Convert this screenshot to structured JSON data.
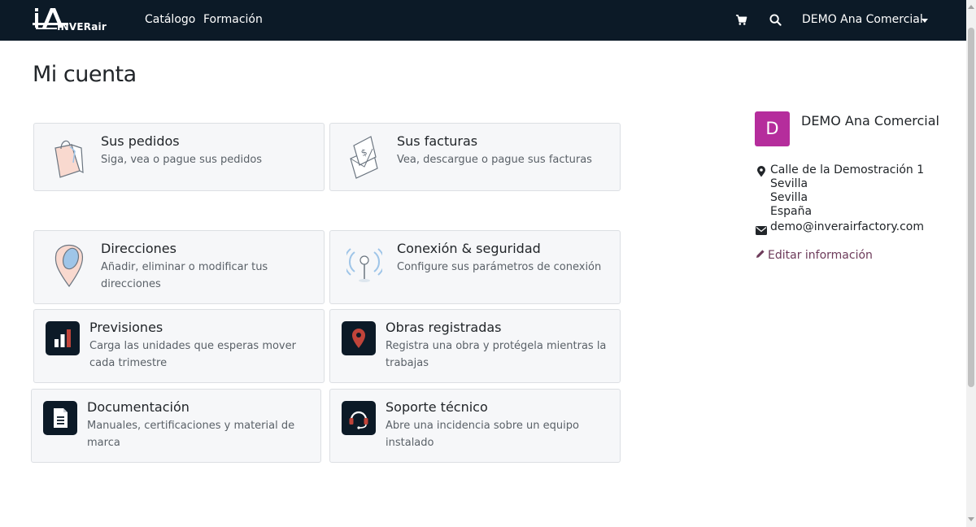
{
  "brand": {
    "name": "INVERair",
    "logo_mark": "iA"
  },
  "nav": {
    "links": [
      "Catálogo",
      "Formación"
    ],
    "user": "DEMO Ana Comercial"
  },
  "page": {
    "title": "Mi cuenta"
  },
  "cards": [
    {
      "title": "Sus pedidos",
      "desc": "Siga, vea o pague sus pedidos",
      "icon": "shopping-bag-icon"
    },
    {
      "title": "Sus facturas",
      "desc": "Vea, descargue o pague sus facturas",
      "icon": "invoice-envelope-icon"
    },
    {
      "title": "Direcciones",
      "desc": "Añadir, eliminar o modificar tus direcciones",
      "icon": "map-pin-icon"
    },
    {
      "title": "Conexión & seguridad",
      "desc": "Configure sus parámetros de conexión",
      "icon": "signal-antenna-icon"
    },
    {
      "title": "Previsiones",
      "desc": "Carga las unidades que esperas mover cada trimestre",
      "icon": "bar-chart-icon"
    },
    {
      "title": "Obras registradas",
      "desc": "Registra una obra y protégela mientras la trabajas",
      "icon": "location-pin-icon"
    },
    {
      "title": "Documentación",
      "desc": "Manuales, certificaciones y material de marca",
      "icon": "document-icon"
    },
    {
      "title": "Soporte técnico",
      "desc": "Abre una incidencia sobre un equipo instalado",
      "icon": "headset-icon"
    }
  ],
  "profile": {
    "initial": "D",
    "name": "DEMO Ana Comercial",
    "address": [
      "Calle de la Demostración 1",
      "Sevilla",
      "Sevilla",
      "España"
    ],
    "email": "demo@inverairfactory.com",
    "edit_label": "Editar información"
  },
  "colors": {
    "navbar": "#0c1a27",
    "avatar": "#b52d9c",
    "card_bg": "#f6f7f9",
    "edit_link": "#6d3b5a",
    "accent_red": "#c0443a"
  }
}
